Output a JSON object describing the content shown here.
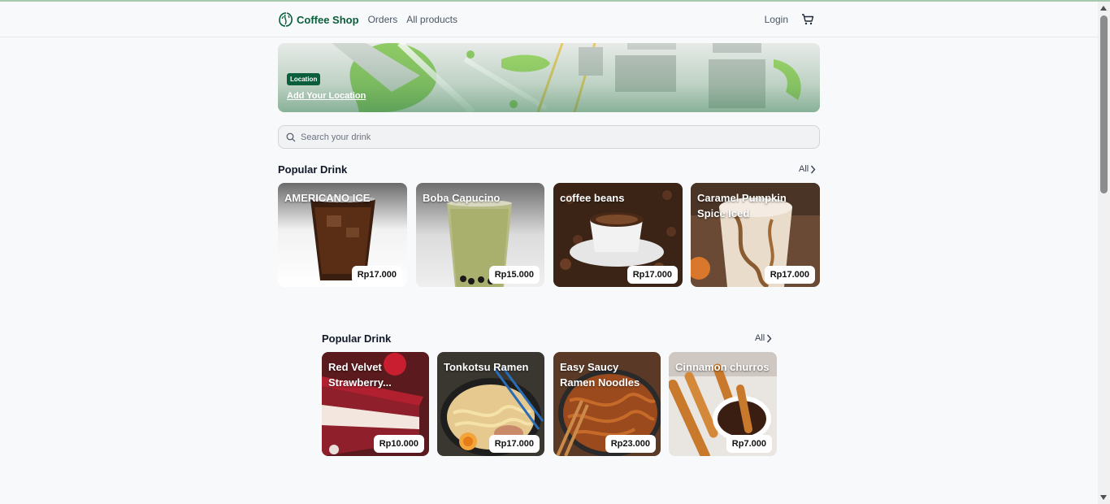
{
  "nav": {
    "brand": "Coffee Shop",
    "links": [
      "Orders",
      "All products"
    ],
    "login": "Login"
  },
  "banner": {
    "badge": "Location",
    "link": "Add Your Location"
  },
  "search": {
    "placeholder": "Search your drink"
  },
  "sections": [
    {
      "title": "Popular Drink",
      "all_label": "All",
      "items": [
        {
          "name": "AMERICANO ICE",
          "price": "Rp17.000"
        },
        {
          "name": "Boba Capucino",
          "price": "Rp15.000"
        },
        {
          "name": "coffee beans",
          "price": "Rp17.000"
        },
        {
          "name": "Caramel Pumpkin Spice Iced",
          "price": "Rp17.000"
        }
      ]
    },
    {
      "title": "Popular Drink",
      "all_label": "All",
      "items": [
        {
          "name": "Red Velvet Strawberry...",
          "price": "Rp10.000"
        },
        {
          "name": "Tonkotsu Ramen",
          "price": "Rp17.000"
        },
        {
          "name": "Easy Saucy Ramen Noodles",
          "price": "Rp23.000"
        },
        {
          "name": "Cinnamon churros",
          "price": "Rp7.000"
        }
      ]
    }
  ],
  "colors": {
    "brand": "#0b5e3b",
    "accent": "#0b5e3b"
  }
}
